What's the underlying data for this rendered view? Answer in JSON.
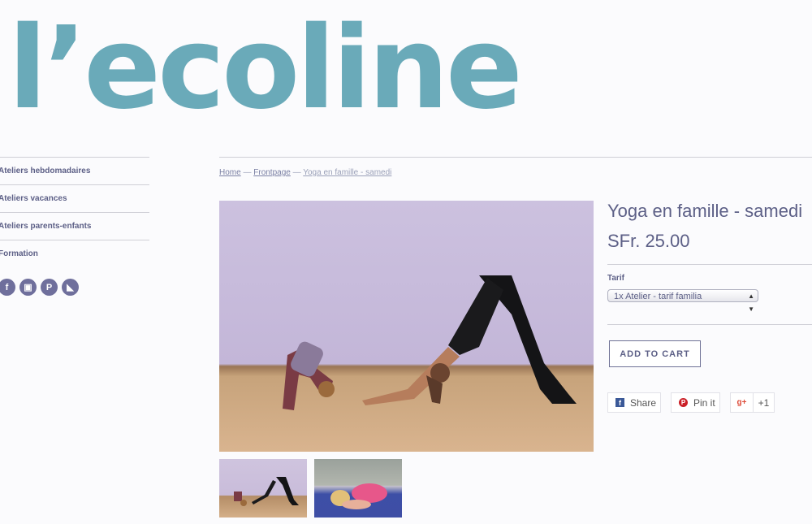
{
  "logo": {
    "text": "l’ecoline"
  },
  "sidebar": {
    "items": [
      {
        "label": "Ateliers hebdomadaires"
      },
      {
        "label": "Ateliers vacances"
      },
      {
        "label": "Ateliers parents-enfants"
      },
      {
        "label": "Formation"
      }
    ],
    "socials": [
      {
        "icon": "facebook-icon",
        "glyph": "f"
      },
      {
        "icon": "instagram-icon",
        "glyph": "▣"
      },
      {
        "icon": "pinterest-icon",
        "glyph": "P"
      },
      {
        "icon": "rss-icon",
        "glyph": "◣"
      }
    ]
  },
  "breadcrumb": {
    "home": "Home",
    "sep1": " — ",
    "frontpage": "Frontpage",
    "sep2": " — ",
    "current": "Yoga en famille - samedi"
  },
  "product": {
    "title": "Yoga en famille - samedi",
    "price": "SFr. 25.00",
    "tarif_label": "Tarif",
    "tarif_selected": "1x Atelier - tarif familia",
    "add_to_cart": "ADD TO CART"
  },
  "share": {
    "facebook": "Share",
    "pinterest": "Pin it",
    "gplus_icon": "g+",
    "gplus_count": "+1"
  },
  "colors": {
    "logo": "#6aaab9",
    "text": "#5c5f86",
    "background": "#fbfbfd"
  }
}
